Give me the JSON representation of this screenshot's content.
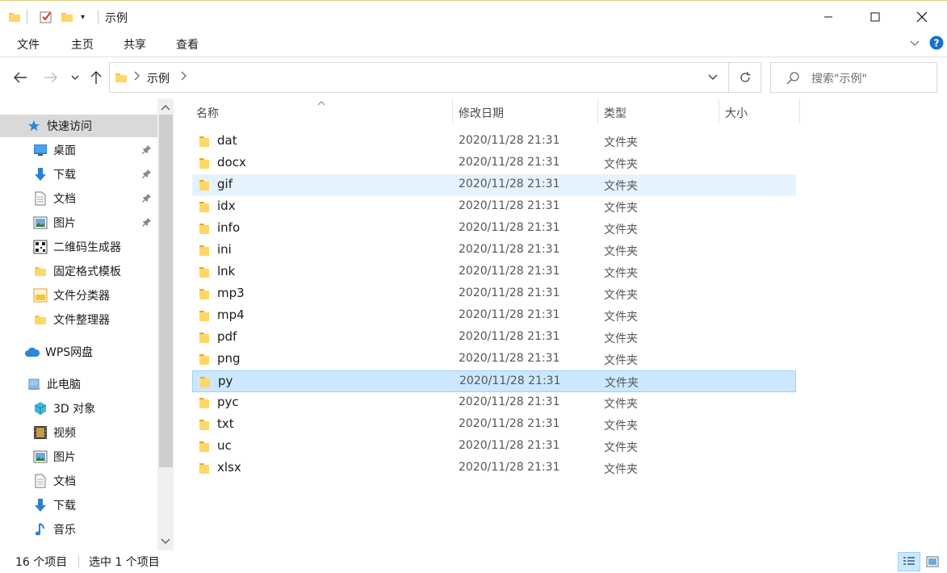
{
  "window": {
    "title": "示例"
  },
  "ribbon": {
    "tabs": [
      "文件",
      "主页",
      "共享",
      "查看"
    ]
  },
  "address": {
    "path": "示例"
  },
  "search": {
    "placeholder": "搜索\"示例\""
  },
  "sidebar": {
    "quick_access": "快速访问",
    "quick_items": [
      "桌面",
      "下载",
      "文档",
      "图片",
      "二维码生成器",
      "固定格式模板",
      "文件分类器",
      "文件整理器"
    ],
    "wps": "WPS网盘",
    "pc": "此电脑",
    "pc_items": [
      "3D 对象",
      "视频",
      "图片",
      "文档",
      "下载",
      "音乐"
    ]
  },
  "columns": {
    "name": "名称",
    "date": "修改日期",
    "type": "类型",
    "size": "大小"
  },
  "files": [
    {
      "name": "dat",
      "date": "2020/11/28 21:31",
      "type": "文件夹"
    },
    {
      "name": "docx",
      "date": "2020/11/28 21:31",
      "type": "文件夹"
    },
    {
      "name": "gif",
      "date": "2020/11/28 21:31",
      "type": "文件夹"
    },
    {
      "name": "idx",
      "date": "2020/11/28 21:31",
      "type": "文件夹"
    },
    {
      "name": "info",
      "date": "2020/11/28 21:31",
      "type": "文件夹"
    },
    {
      "name": "ini",
      "date": "2020/11/28 21:31",
      "type": "文件夹"
    },
    {
      "name": "lnk",
      "date": "2020/11/28 21:31",
      "type": "文件夹"
    },
    {
      "name": "mp3",
      "date": "2020/11/28 21:31",
      "type": "文件夹"
    },
    {
      "name": "mp4",
      "date": "2020/11/28 21:31",
      "type": "文件夹"
    },
    {
      "name": "pdf",
      "date": "2020/11/28 21:31",
      "type": "文件夹"
    },
    {
      "name": "png",
      "date": "2020/11/28 21:31",
      "type": "文件夹"
    },
    {
      "name": "py",
      "date": "2020/11/28 21:31",
      "type": "文件夹"
    },
    {
      "name": "pyc",
      "date": "2020/11/28 21:31",
      "type": "文件夹"
    },
    {
      "name": "txt",
      "date": "2020/11/28 21:31",
      "type": "文件夹"
    },
    {
      "name": "uc",
      "date": "2020/11/28 21:31",
      "type": "文件夹"
    },
    {
      "name": "xlsx",
      "date": "2020/11/28 21:31",
      "type": "文件夹"
    }
  ],
  "status": {
    "count": "16 个项目",
    "selected": "选中 1 个项目"
  },
  "colors": {
    "selected_row": "#cce8ff",
    "hover_row": "#e5f3ff",
    "folder": "#f5c342",
    "accent": "#0f6cbd"
  }
}
